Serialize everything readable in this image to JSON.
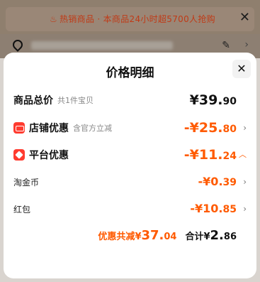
{
  "banner": {
    "notice_icon": "flame-icon",
    "notice_text": "热销商品 · 本商品24小时超5700人抢购",
    "close": "✕"
  },
  "sheet": {
    "title": "价格明细",
    "close": "✕",
    "rows": [
      {
        "label": "商品总价",
        "sub": "共1件宝贝",
        "value_int": "¥39.",
        "value_dec": "90"
      },
      {
        "label": "店铺优惠",
        "sub": "含官方立减",
        "value_int": "-¥25.",
        "value_dec": "80"
      },
      {
        "label": "平台优惠",
        "sub": "",
        "value_int": "-¥11.",
        "value_dec": "24"
      },
      {
        "label": "淘金币",
        "sub": "",
        "value_int": "-¥0.",
        "value_dec": "39"
      },
      {
        "label": "红包",
        "sub": "",
        "value_int": "-¥10.",
        "value_dec": "85"
      }
    ],
    "summary": {
      "discount_label": "优惠共减",
      "discount_cur": "¥",
      "discount_int": "37.",
      "discount_dec": "04",
      "total_label": "合计",
      "total_cur": "¥",
      "total_int": "2.",
      "total_dec": "86"
    }
  },
  "colors": {
    "accent": "#ff5a00",
    "icon_red": "#ff3b2f"
  }
}
